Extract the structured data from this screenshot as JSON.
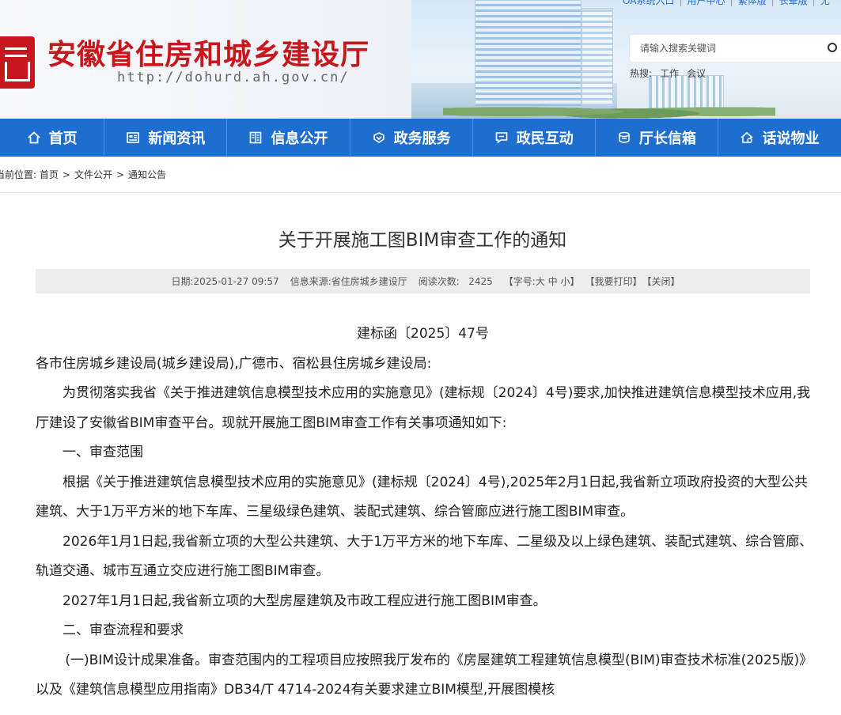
{
  "header": {
    "site_title": "安徽省住房和城乡建设厅",
    "site_url": "http://dohurd.ah.gov.cn/",
    "top_links": [
      "OA系统入口",
      "用户中心",
      "繁体版",
      "长辈版",
      "无"
    ],
    "search_placeholder": "请输入搜索关键词",
    "hot_label": "热搜:",
    "hot_terms": [
      "工作",
      "会议"
    ]
  },
  "nav": {
    "items": [
      {
        "label": "首页",
        "icon": "home-icon"
      },
      {
        "label": "新闻资讯",
        "icon": "news-icon"
      },
      {
        "label": "信息公开",
        "icon": "book-icon"
      },
      {
        "label": "政务服务",
        "icon": "service-icon"
      },
      {
        "label": "政民互动",
        "icon": "chat-icon"
      },
      {
        "label": "厅长信箱",
        "icon": "mailbox-icon"
      },
      {
        "label": "话说物业",
        "icon": "property-icon"
      }
    ]
  },
  "breadcrumb": {
    "prefix": "当前位置:",
    "items": [
      "首页",
      "文件公开",
      "通知公告"
    ]
  },
  "article": {
    "title": "关于开展施工图BIM审查工作的通知",
    "meta": {
      "date": "日期:2025-01-27 09:57",
      "source": "信息来源:省住房城乡建设厅",
      "views_label": "阅读次数:",
      "views": "2425",
      "font_size": "【字号:大 中 小】",
      "print": "【我要打印】",
      "close": "【关闭】"
    },
    "doc_no": "建标函〔2025〕47号",
    "addressee": "各市住房城乡建设局(城乡建设局),广德市、宿松县住房城乡建设局:",
    "intro": "为贯彻落实我省《关于推进建筑信息模型技术应用的实施意见》(建标规〔2024〕4号)要求,加快推进建筑信息模型技术应用,我厅建设了安徽省BIM审查平台。现就开展施工图BIM审查工作有关事项通知如下:",
    "section1": "一、审查范围",
    "s1p1": "根据《关于推进建筑信息模型技术应用的实施意见》(建标规〔2024〕4号),2025年2月1日起,我省新立项政府投资的大型公共建筑、大于1万平方米的地下车库、三星级绿色建筑、装配式建筑、综合管廊应进行施工图BIM审查。",
    "s1p2": "2026年1月1日起,我省新立项的大型公共建筑、大于1万平方米的地下车库、二星级及以上绿色建筑、装配式建筑、综合管廊、轨道交通、城市互通立交应进行施工图BIM审查。",
    "s1p3": "2027年1月1日起,我省新立项的大型房屋建筑及市政工程应进行施工图BIM审查。",
    "section2": "二、审查流程和要求",
    "s2p1": "(一)BIM设计成果准备。审查范围内的工程项目应按照我厅发布的《房屋建筑工程建筑信息模型(BIM)审查技术标准(2025版)》以及《建筑信息模型应用指南》DB34/T 4714-2024有关要求建立BIM模型,开展图模核"
  }
}
